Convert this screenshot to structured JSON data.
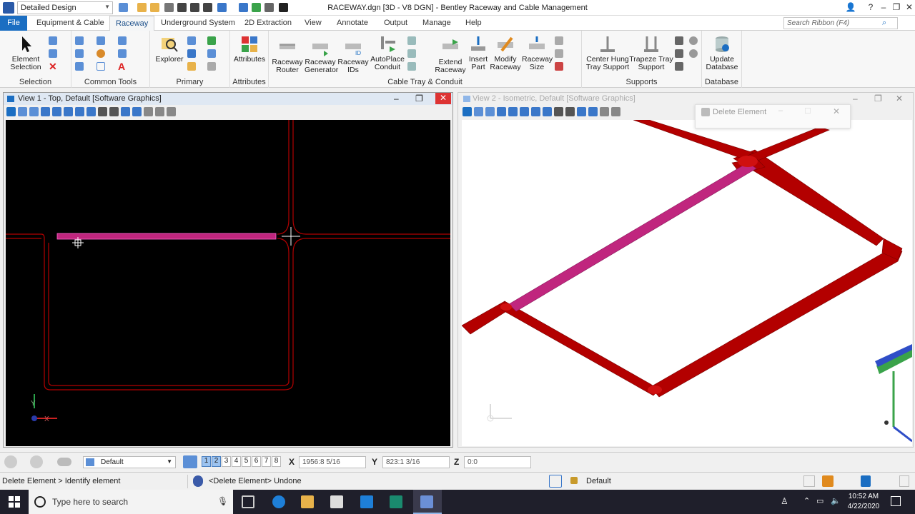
{
  "title_bar": {
    "workspace": "Detailed Design",
    "title": "RACEWAY.dgn [3D - V8 DGN] - Bentley Raceway and Cable Management"
  },
  "menu": {
    "file": "File",
    "tabs": [
      "Equipment & Cable",
      "Raceway",
      "Underground System",
      "2D Extraction",
      "View",
      "Annotate",
      "Output",
      "Manage",
      "Help"
    ],
    "active_tab": "Raceway",
    "search_placeholder": "Search Ribbon (F4)"
  },
  "ribbon": {
    "groups": [
      "Selection",
      "Common Tools",
      "Primary",
      "Attributes",
      "Cable Tray & Conduit",
      "Supports",
      "Database"
    ],
    "element_selection": "Element Selection",
    "explorer": "Explorer",
    "attributes": "Attributes",
    "raceway_router": "Raceway Router",
    "raceway_generator": "Raceway Generator",
    "raceway_ids": "Raceway IDs",
    "autoplace_conduit": "AutoPlace Conduit",
    "extend_raceway": "Extend Raceway",
    "insert_part": "Insert Part",
    "modify_raceway": "Modify Raceway",
    "raceway_size": "Raceway Size",
    "center_hung": "Center Hung Tray Support",
    "trapeze": "Trapeze Tray Support",
    "update_database": "Update Database"
  },
  "views": {
    "view1_title": "View 1 - Top, Default [Software Graphics]",
    "view2_title": "View 2 - Isometric, Default [Software Graphics]",
    "delete_dialog_title": "Delete Element"
  },
  "status": {
    "level": "Default",
    "view_numbers": [
      "1",
      "2",
      "3",
      "4",
      "5",
      "6",
      "7",
      "8"
    ],
    "x_label": "X",
    "x_value": "1956:8 5/16",
    "y_label": "Y",
    "y_value": "823:1 3/16",
    "z_label": "Z",
    "z_value": "0:0",
    "prompt": "Delete Element > Identify element",
    "message": "<Delete Element> Undone",
    "active_level": "Default"
  },
  "taskbar": {
    "search": "Type here to search",
    "time": "10:52 AM",
    "date": "4/22/2020"
  },
  "colors": {
    "accent": "#1b6ec2",
    "tray_red": "#b30000",
    "tray_magenta": "#c0267e"
  }
}
